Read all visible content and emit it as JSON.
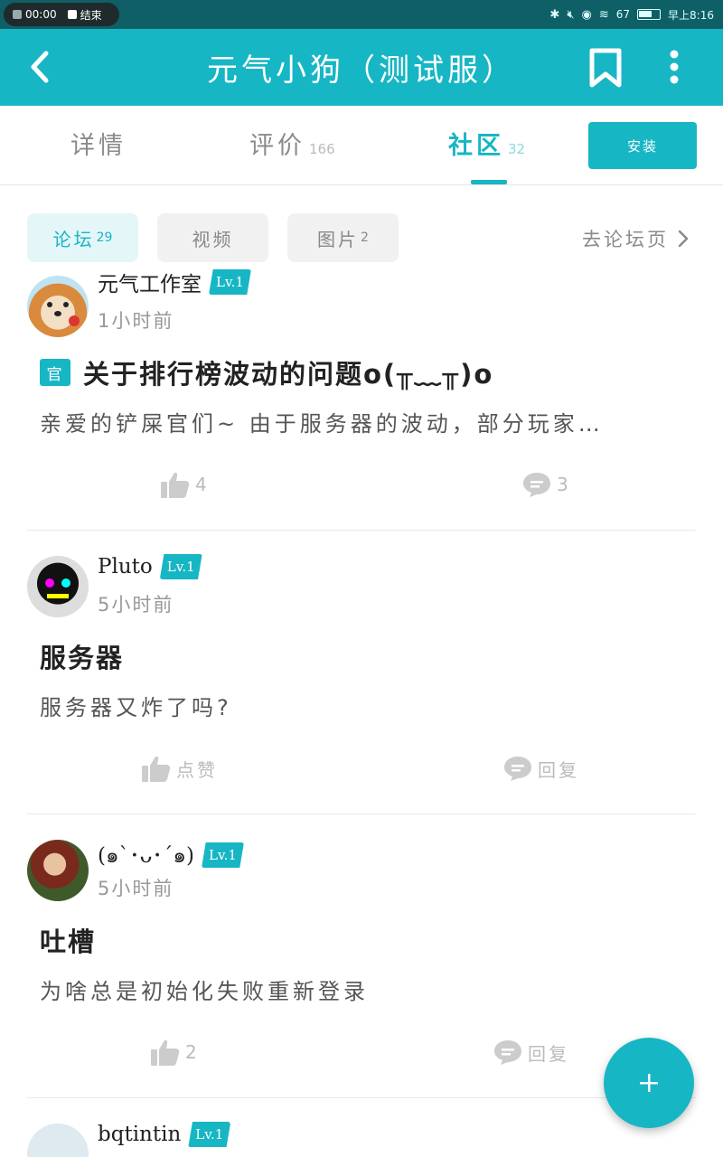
{
  "status_bar": {
    "recording_time": "00:00",
    "end_label": "结束",
    "battery_percent": "67",
    "clock": "早上8:16"
  },
  "app_bar": {
    "title": "元气小狗（测试服）"
  },
  "tabs": [
    {
      "label": "详情",
      "count": ""
    },
    {
      "label": "评价",
      "count": "166"
    },
    {
      "label": "社区",
      "count": "32"
    }
  ],
  "install_label": "安装",
  "filters": [
    {
      "label": "论坛",
      "count": "29"
    },
    {
      "label": "视频",
      "count": ""
    },
    {
      "label": "图片",
      "count": "2"
    }
  ],
  "forum_link": "去论坛页",
  "posts": [
    {
      "username": "元气工作室",
      "level": "Lv.1",
      "time": "1小时前",
      "official_tag": "官",
      "title": "关于排行榜波动的问题o(╥﹏╥)o",
      "body": "亲爱的铲屎官们~ 由于服务器的波动，部分玩家…",
      "likes": "4",
      "replies": "3"
    },
    {
      "username": "Pluto",
      "level": "Lv.1",
      "time": "5小时前",
      "title": "服务器",
      "body": "服务器又炸了吗?",
      "likes": "点赞",
      "replies": "回复"
    },
    {
      "username": "(๑`･ᴗ･´๑)",
      "level": "Lv.1",
      "time": "5小时前",
      "title": "吐槽",
      "body": "为啥总是初始化失败重新登录",
      "likes": "2",
      "replies": "回复"
    },
    {
      "username": "bqtintin",
      "level": "Lv.1"
    }
  ],
  "colors": {
    "accent": "#17b6c4",
    "status_bar": "#0f5f66"
  }
}
